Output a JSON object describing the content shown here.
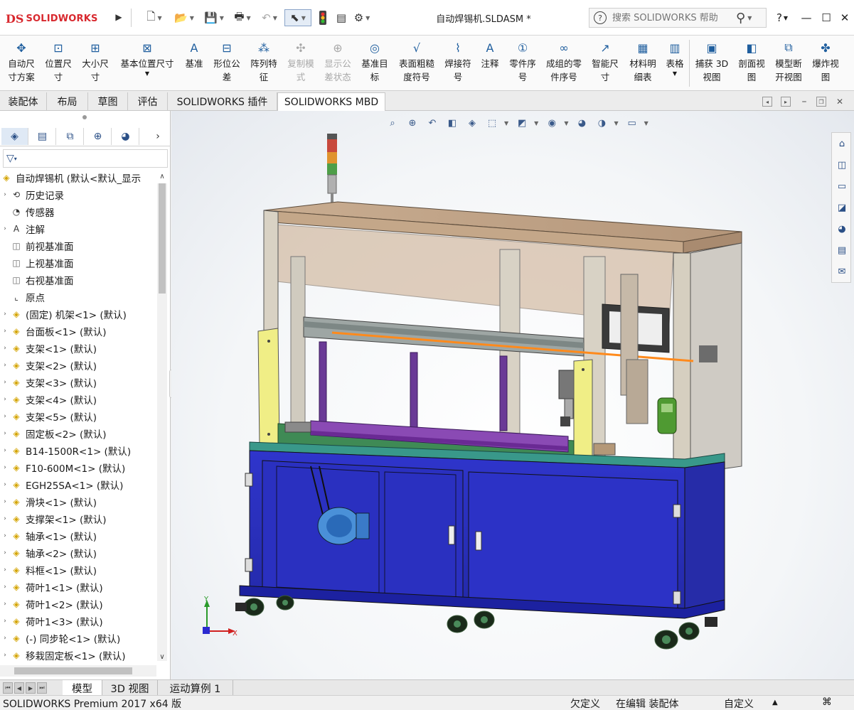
{
  "app": {
    "logo_prefix": "DS",
    "logo_text": "SOLIDWORKS",
    "document_title": "自动焊锡机.SLDASM *"
  },
  "search": {
    "placeholder": "搜索 SOLIDWORKS 帮助"
  },
  "window_buttons": {
    "help": "?",
    "minimize": "—",
    "maximize": "☐",
    "close": "✕"
  },
  "quick_access": [
    "new-icon",
    "open-icon",
    "save-icon",
    "print-icon",
    "undo-icon",
    "select-icon",
    "rebuild-icon",
    "file-properties-icon",
    "options-icon"
  ],
  "commands": [
    {
      "label": "自动尺\n寸方案",
      "icon": "auto-dimension-scheme-icon",
      "enabled": true
    },
    {
      "label": "位置尺\n寸",
      "icon": "location-dimension-icon",
      "enabled": true
    },
    {
      "label": "大小尺\n寸",
      "icon": "size-dimension-icon",
      "enabled": true
    },
    {
      "label": "基本位置尺寸",
      "icon": "basic-location-dimension-icon",
      "enabled": true
    },
    {
      "label": "基准",
      "icon": "datum-icon",
      "enabled": true
    },
    {
      "label": "形位公\n差",
      "icon": "geometric-tolerance-icon",
      "enabled": true
    },
    {
      "label": "阵列特\n征",
      "icon": "pattern-feature-icon",
      "enabled": true
    },
    {
      "label": "复制模\n式",
      "icon": "copy-scheme-icon",
      "enabled": false
    },
    {
      "label": "显示公\n差状态",
      "icon": "show-tolerance-status-icon",
      "enabled": false
    },
    {
      "label": "基准目\n标",
      "icon": "datum-target-icon",
      "enabled": true
    },
    {
      "label": "表面粗糙\n度符号",
      "icon": "surface-finish-icon",
      "enabled": true
    },
    {
      "label": "焊接符\n号",
      "icon": "weld-symbol-icon",
      "enabled": true
    },
    {
      "label": "注释",
      "icon": "note-icon",
      "enabled": true
    },
    {
      "label": "零件序\n号",
      "icon": "balloon-icon",
      "enabled": true
    },
    {
      "label": "成组的零\n件序号",
      "icon": "stacked-balloon-icon",
      "enabled": true
    },
    {
      "label": "智能尺\n寸",
      "icon": "smart-dimension-icon",
      "enabled": true
    },
    {
      "label": "材料明\n细表",
      "icon": "bom-icon",
      "enabled": true
    },
    {
      "label": "表格",
      "icon": "table-icon",
      "enabled": true
    },
    {
      "label": "捕获 3D\n视图",
      "icon": "capture-3d-view-icon",
      "enabled": true
    },
    {
      "label": "剖面视\n图",
      "icon": "section-view-icon",
      "enabled": true
    },
    {
      "label": "模型断\n开视图",
      "icon": "model-break-view-icon",
      "enabled": true
    },
    {
      "label": "爆炸视\n图",
      "icon": "exploded-view-icon",
      "enabled": true
    }
  ],
  "cm_tabs": [
    {
      "label": "装配体",
      "active": false
    },
    {
      "label": "布局",
      "active": false
    },
    {
      "label": "草图",
      "active": false
    },
    {
      "label": "评估",
      "active": false
    },
    {
      "label": "SOLIDWORKS 插件",
      "active": false
    },
    {
      "label": "SOLIDWORKS MBD",
      "active": true
    }
  ],
  "feature_manager": {
    "tabs": [
      "feature-manager-icon",
      "property-manager-icon",
      "configuration-manager-icon",
      "dimxpert-icon",
      "display-manager-icon"
    ],
    "more": "›",
    "root": "自动焊锡机  (默认<默认_显示",
    "items": [
      {
        "label": "历史记录",
        "expand": true,
        "icon": "history-icon",
        "kind": "sys"
      },
      {
        "label": "传感器",
        "expand": false,
        "icon": "sensor-icon",
        "kind": "sys"
      },
      {
        "label": "注解",
        "expand": true,
        "icon": "annotation-icon",
        "kind": "sys"
      },
      {
        "label": "前视基准面",
        "expand": false,
        "icon": "plane-icon",
        "kind": "plane"
      },
      {
        "label": "上视基准面",
        "expand": false,
        "icon": "plane-icon",
        "kind": "plane"
      },
      {
        "label": "右视基准面",
        "expand": false,
        "icon": "plane-icon",
        "kind": "plane"
      },
      {
        "label": "原点",
        "expand": false,
        "icon": "origin-icon",
        "kind": "sys"
      },
      {
        "label": "(固定) 机架<1> (默认)",
        "expand": true,
        "icon": "subassembly-icon",
        "kind": "part"
      },
      {
        "label": "台面板<1> (默认)",
        "expand": true,
        "icon": "part-icon",
        "kind": "part"
      },
      {
        "label": "支架<1> (默认)",
        "expand": true,
        "icon": "part-icon",
        "kind": "part"
      },
      {
        "label": "支架<2> (默认)",
        "expand": true,
        "icon": "part-icon",
        "kind": "part"
      },
      {
        "label": "支架<3> (默认)",
        "expand": true,
        "icon": "part-icon",
        "kind": "part"
      },
      {
        "label": "支架<4> (默认)",
        "expand": true,
        "icon": "part-icon",
        "kind": "part"
      },
      {
        "label": "支架<5> (默认)",
        "expand": true,
        "icon": "part-icon",
        "kind": "part"
      },
      {
        "label": "固定板<2> (默认)",
        "expand": true,
        "icon": "part-icon",
        "kind": "part"
      },
      {
        "label": "B14-1500R<1> (默认)",
        "expand": true,
        "icon": "subassembly-icon",
        "kind": "part"
      },
      {
        "label": "F10-600M<1> (默认)",
        "expand": true,
        "icon": "subassembly-icon",
        "kind": "part"
      },
      {
        "label": "EGH25SA<1> (默认)",
        "expand": true,
        "icon": "subassembly-icon",
        "kind": "part"
      },
      {
        "label": "滑块<1> (默认)",
        "expand": true,
        "icon": "part-icon",
        "kind": "part"
      },
      {
        "label": "支撑架<1> (默认)",
        "expand": true,
        "icon": "part-icon",
        "kind": "part"
      },
      {
        "label": "轴承<1> (默认)",
        "expand": true,
        "icon": "part-icon",
        "kind": "part"
      },
      {
        "label": "轴承<2> (默认)",
        "expand": true,
        "icon": "part-icon",
        "kind": "part"
      },
      {
        "label": "料框<1> (默认)",
        "expand": true,
        "icon": "part-icon",
        "kind": "part"
      },
      {
        "label": "荷叶1<1> (默认)",
        "expand": true,
        "icon": "part-icon",
        "kind": "part"
      },
      {
        "label": "荷叶1<2> (默认)",
        "expand": true,
        "icon": "part-icon",
        "kind": "part"
      },
      {
        "label": "荷叶1<3> (默认)",
        "expand": true,
        "icon": "part-icon",
        "kind": "part"
      },
      {
        "label": "(-) 同步轮<1> (默认)",
        "expand": true,
        "icon": "part-icon",
        "kind": "part"
      },
      {
        "label": "移栽固定板<1> (默认)",
        "expand": true,
        "icon": "part-icon",
        "kind": "part"
      }
    ]
  },
  "hud_icons": [
    "zoom-to-fit-icon",
    "zoom-area-icon",
    "previous-view-icon",
    "section-view-icon",
    "dynamic-annotation-icon",
    "view-orientation-icon",
    "display-style-icon",
    "hide-show-icon",
    "edit-appearance-icon",
    "apply-scene-icon",
    "view-settings-icon"
  ],
  "task_pane": [
    "home-icon",
    "design-library-icon",
    "file-explorer-icon",
    "view-palette-icon",
    "appearances-icon",
    "custom-properties-icon",
    "forum-icon"
  ],
  "bottom_tabs": [
    {
      "label": "模型",
      "active": true
    },
    {
      "label": "3D 视图",
      "active": false
    },
    {
      "label": "运动算例 1",
      "active": false
    }
  ],
  "axis": {
    "x": "X",
    "y": "Y"
  },
  "status": {
    "product": "SOLIDWORKS Premium 2017 x64 版",
    "defined": "欠定义",
    "editing": "在编辑 装配体",
    "units": "自定义"
  },
  "colors": {
    "brand": "#d8282e",
    "cabinet_blue": "#2e34c8",
    "frame_tan": "#b89a7c",
    "guard_yellow": "#f0ee86",
    "bed_green": "#3f8a55",
    "rail_purple": "#7b3fa6",
    "laser_orange": "#ff8a1c"
  }
}
